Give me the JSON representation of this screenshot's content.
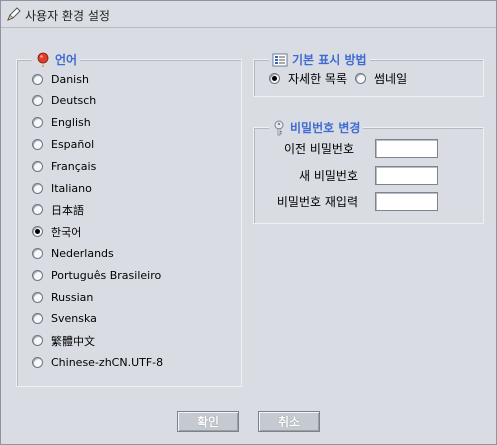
{
  "window": {
    "title": "사용자 환경 설정"
  },
  "language": {
    "legend": "언어",
    "options": [
      "Danish",
      "Deutsch",
      "English",
      "Español",
      "Français",
      "Italiano",
      "日本語",
      "한국어",
      "Nederlands",
      "Português Brasileiro",
      "Russian",
      "Svenska",
      "繁體中文",
      "Chinese-zhCN.UTF-8"
    ],
    "selected": "한국어"
  },
  "display": {
    "legend": "기본 표시 방법",
    "options": [
      "자세한 목록",
      "썸네일"
    ],
    "selected": "자세한 목록"
  },
  "password": {
    "legend": "비밀번호 변경",
    "fields": [
      {
        "label": "이전 비밀번호",
        "value": ""
      },
      {
        "label": "새 비밀번호",
        "value": ""
      },
      {
        "label": "비밀번호 재입력",
        "value": ""
      }
    ]
  },
  "buttons": {
    "ok": "확인",
    "cancel": "취소"
  },
  "colors": {
    "accent": "#3f6bd3",
    "background": "#d9dde3"
  },
  "icons": {
    "title": "pencil-icon",
    "language": "balloon-icon",
    "display": "list-view-icon",
    "password": "key-icon"
  }
}
